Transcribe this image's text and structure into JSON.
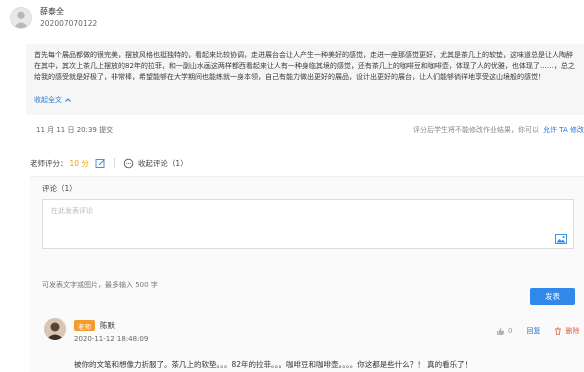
{
  "user": {
    "name": "薛泰全",
    "id": "202007070122"
  },
  "essay": {
    "text": "首先每个展品都做的很完美，摆放风格也挺独特的，看起来比较协调，走进展台会让人产生一种美好的感觉，走进一座那感觉更好，尤其是茶几上的软垫，这味道总是让人陶醉在其中，其次上茶几上摆放的82年的拉菲，和一副山水画这两样都西看起来让人有一种身临其境的感觉，还有茶几上的咖啡豆和咖啡壶，体现了人的优雅，也体现了……，总之给我的感受就是好极了，非常棒，希望能够在大学期间也能练就一身本领，自己有能力做出更好的展品，设计出更好的展台，让人们能够徜徉地享受这山境般的感觉！",
    "collapse_label": "收起全文"
  },
  "submit": {
    "time": "11 月 11 日 20:39 提交",
    "notice": "评分后学生将不能修改作业结果，你可以",
    "allow_label": "允许 TA 修改"
  },
  "score": {
    "label": "老师评分：",
    "value": "10 分",
    "collapse_comments": "收起评论（1）"
  },
  "comment": {
    "title": "评论（1）",
    "placeholder": "在此发表评论",
    "hint": "可发表文字或图片，最多输入 500 字",
    "send_label": "发表"
  },
  "reply": {
    "tag": "老师",
    "author": "陈默",
    "time": "2020-11-12 18:48:09",
    "likes": "0",
    "reply_label": "回复",
    "delete_label": "删除",
    "text": "被你的文笔和想像力折服了。茶几上的软垫。。。82年的拉菲。。。咖啡豆和咖啡壶。。。。你这都是些什么？！ 真的看乐了！"
  }
}
